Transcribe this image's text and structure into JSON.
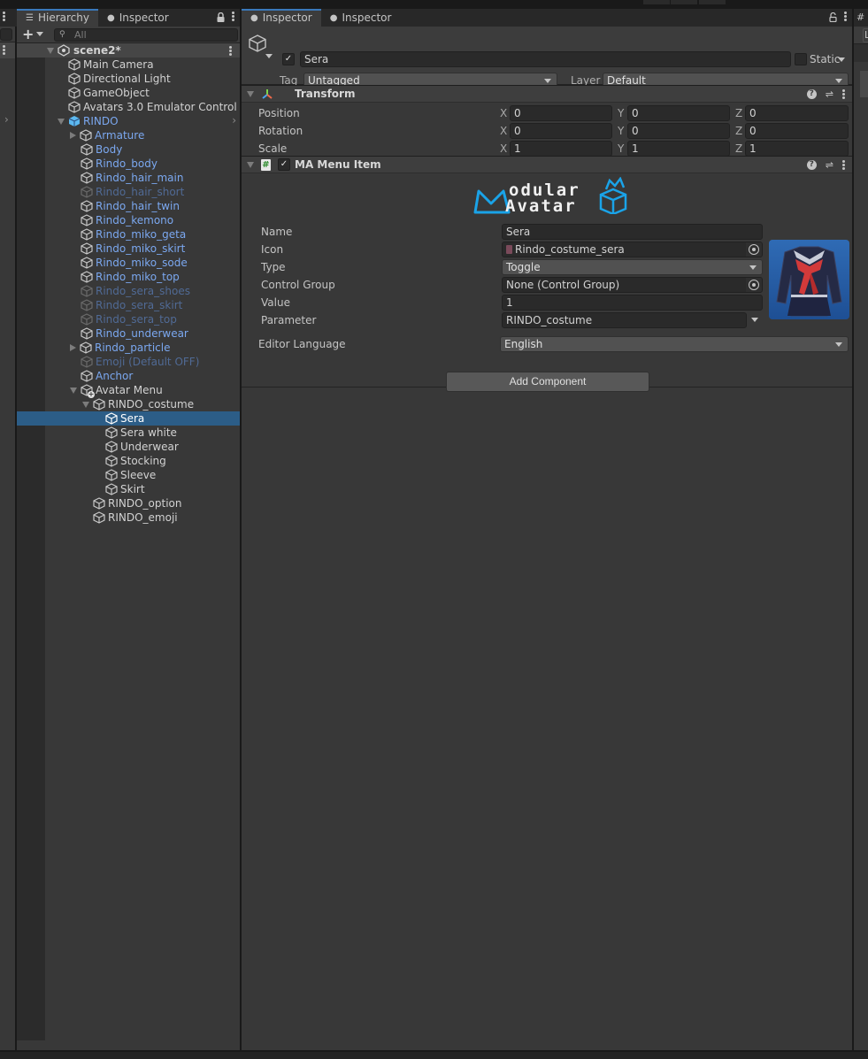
{
  "hierarchy": {
    "tabs": [
      {
        "label": "Hierarchy",
        "icon": "list-icon",
        "active": true
      },
      {
        "label": "Inspector",
        "icon": "info-icon",
        "active": false
      }
    ],
    "search_placeholder": "All",
    "scene_name": "scene2*",
    "items": [
      {
        "label": "Main Camera",
        "depth": 0,
        "expand": "none",
        "style": "white"
      },
      {
        "label": "Directional Light",
        "depth": 0,
        "expand": "none",
        "style": "white"
      },
      {
        "label": "GameObject",
        "depth": 0,
        "expand": "none",
        "style": "white"
      },
      {
        "label": "Avatars 3.0 Emulator Control",
        "depth": 0,
        "expand": "none",
        "style": "white"
      },
      {
        "label": "RINDO",
        "depth": 0,
        "expand": "open",
        "style": "blue",
        "prefab_root": true
      },
      {
        "label": "Armature",
        "depth": 1,
        "expand": "closed",
        "style": "blue"
      },
      {
        "label": "Body",
        "depth": 1,
        "expand": "none",
        "style": "blue"
      },
      {
        "label": "Rindo_body",
        "depth": 1,
        "expand": "none",
        "style": "blue"
      },
      {
        "label": "Rindo_hair_main",
        "depth": 1,
        "expand": "none",
        "style": "blue"
      },
      {
        "label": "Rindo_hair_short",
        "depth": 1,
        "expand": "none",
        "style": "blue-dim"
      },
      {
        "label": "Rindo_hair_twin",
        "depth": 1,
        "expand": "none",
        "style": "blue"
      },
      {
        "label": "Rindo_kemono",
        "depth": 1,
        "expand": "none",
        "style": "blue"
      },
      {
        "label": "Rindo_miko_geta",
        "depth": 1,
        "expand": "none",
        "style": "blue"
      },
      {
        "label": "Rindo_miko_skirt",
        "depth": 1,
        "expand": "none",
        "style": "blue"
      },
      {
        "label": "Rindo_miko_sode",
        "depth": 1,
        "expand": "none",
        "style": "blue"
      },
      {
        "label": "Rindo_miko_top",
        "depth": 1,
        "expand": "none",
        "style": "blue"
      },
      {
        "label": "Rindo_sera_shoes",
        "depth": 1,
        "expand": "none",
        "style": "blue-dim"
      },
      {
        "label": "Rindo_sera_skirt",
        "depth": 1,
        "expand": "none",
        "style": "blue-dim"
      },
      {
        "label": "Rindo_sera_top",
        "depth": 1,
        "expand": "none",
        "style": "blue-dim"
      },
      {
        "label": "Rindo_underwear",
        "depth": 1,
        "expand": "none",
        "style": "blue"
      },
      {
        "label": "Rindo_particle",
        "depth": 1,
        "expand": "closed",
        "style": "blue"
      },
      {
        "label": "Emoji (Default OFF)",
        "depth": 1,
        "expand": "none",
        "style": "blue-dim"
      },
      {
        "label": "Anchor",
        "depth": 1,
        "expand": "none",
        "style": "blue"
      },
      {
        "label": "Avatar Menu",
        "depth": 1,
        "expand": "open",
        "style": "white",
        "added": true
      },
      {
        "label": "RINDO_costume",
        "depth": 2,
        "expand": "open",
        "style": "white"
      },
      {
        "label": "Sera",
        "depth": 3,
        "expand": "none",
        "style": "white",
        "selected": true
      },
      {
        "label": "Sera white",
        "depth": 3,
        "expand": "none",
        "style": "white"
      },
      {
        "label": "Underwear",
        "depth": 3,
        "expand": "none",
        "style": "white"
      },
      {
        "label": "Stocking",
        "depth": 3,
        "expand": "none",
        "style": "white"
      },
      {
        "label": "Sleeve",
        "depth": 3,
        "expand": "none",
        "style": "white"
      },
      {
        "label": "Skirt",
        "depth": 3,
        "expand": "none",
        "style": "white"
      },
      {
        "label": "RINDO_option",
        "depth": 2,
        "expand": "none",
        "style": "white"
      },
      {
        "label": "RINDO_emoji",
        "depth": 2,
        "expand": "none",
        "style": "white"
      }
    ]
  },
  "inspector": {
    "tabs": [
      {
        "label": "Inspector",
        "icon": "info-icon",
        "active": true
      },
      {
        "label": "Inspector",
        "icon": "info-icon",
        "active": false
      }
    ],
    "object": {
      "active": true,
      "name": "Sera",
      "static_label": "Static",
      "static": false,
      "tag_label": "Tag",
      "tag_value": "Untagged",
      "layer_label": "Layer",
      "layer_value": "Default"
    },
    "transform": {
      "title": "Transform",
      "rows": [
        {
          "label": "Position",
          "x": "0",
          "y": "0",
          "z": "0"
        },
        {
          "label": "Rotation",
          "x": "0",
          "y": "0",
          "z": "0"
        },
        {
          "label": "Scale",
          "x": "1",
          "y": "1",
          "z": "1"
        }
      ],
      "axis_labels": {
        "x": "X",
        "y": "Y",
        "z": "Z"
      }
    },
    "ma_menu_item": {
      "title": "MA Menu Item",
      "enabled": true,
      "logo_line1": "odular",
      "logo_line2": "Avatar",
      "fields": {
        "name_label": "Name",
        "name_value": "Sera",
        "icon_label": "Icon",
        "icon_value": "Rindo_costume_sera",
        "type_label": "Type",
        "type_value": "Toggle",
        "control_group_label": "Control Group",
        "control_group_value": "None (Control Group)",
        "value_label": "Value",
        "value_value": "1",
        "parameter_label": "Parameter",
        "parameter_value": "RINDO_costume"
      },
      "editor_language_label": "Editor Language",
      "editor_language_value": "English"
    },
    "add_component_label": "Add Component"
  },
  "colors": {
    "selection": "#2c5d87",
    "accent_tab": "#3a79bb",
    "prefab_blue": "#7ba8f0",
    "prefab_blue_inactive": "#506a95",
    "logo_blue": "#1aa3e8"
  }
}
